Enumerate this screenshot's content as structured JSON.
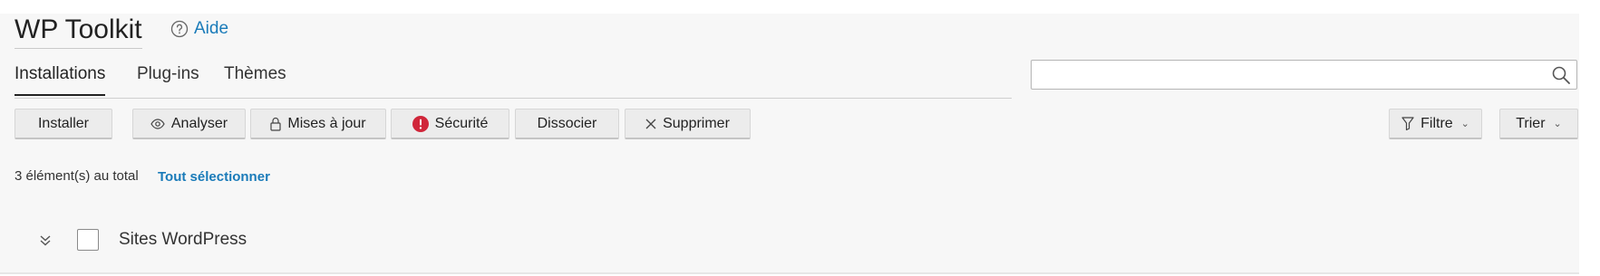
{
  "header": {
    "title": "WP Toolkit",
    "help_label": "Aide"
  },
  "tabs": [
    {
      "label": "Installations",
      "active": true
    },
    {
      "label": "Plug-ins",
      "active": false
    },
    {
      "label": "Thèmes",
      "active": false
    }
  ],
  "search": {
    "value": "",
    "placeholder": ""
  },
  "toolbar": {
    "install_label": "Installer",
    "analyze_label": "Analyser",
    "updates_label": "Mises à jour",
    "security_label": "Sécurité",
    "detach_label": "Dissocier",
    "delete_label": "Supprimer",
    "filter_label": "Filtre",
    "sort_label": "Trier"
  },
  "summary": {
    "total_text": "3 élément(s) au total",
    "select_all_label": "Tout sélectionner"
  },
  "list": {
    "group_label": "Sites WordPress"
  },
  "colors": {
    "accent": "#1a7bb9",
    "danger": "#d0263a",
    "panel_background": "#f7f7f7",
    "button_background": "#ececec"
  },
  "icons": {
    "help": "question-circle-icon",
    "search": "magnifier-icon",
    "analyze": "eye-icon",
    "updates": "lock-icon",
    "security": "exclamation-circle-icon",
    "delete": "close-x-icon",
    "filter": "funnel-icon",
    "expander": "double-chevron-down-icon"
  }
}
